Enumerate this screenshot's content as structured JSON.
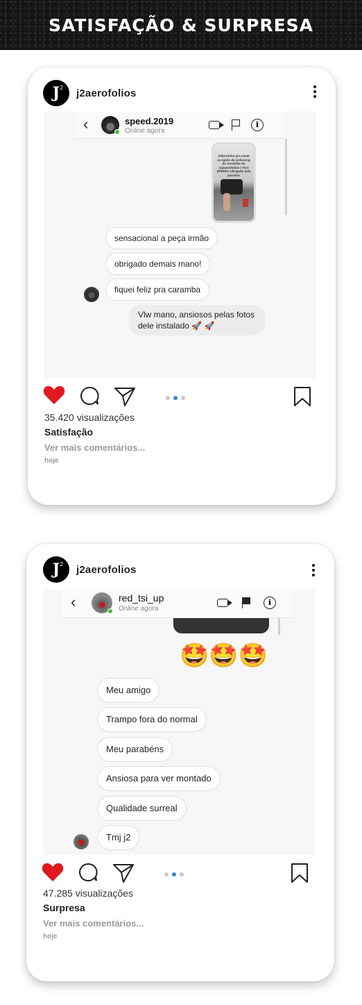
{
  "banner": {
    "title": "SATISFAÇÃO & SURPRESA"
  },
  "posts": [
    {
      "account": {
        "username": "j2aerofolios",
        "logo_letter": "J",
        "logo_sup": "2"
      },
      "chat": {
        "contact": "speed.2019",
        "status": "Online agora",
        "story_text": "Videozinho pra canal no Ignite do Unboxing do Aerofólio do @j2aerofolios | TSI | SPEED!! obrigado pela parceria",
        "incoming": [
          "sensacional a peça irmão",
          "obrigado demais mano!",
          "fiquei feliz pra caramba"
        ],
        "outgoing": [
          "Vlw mano, ansiosos pelas fotos dele instalado 🚀 🚀"
        ]
      },
      "views": "35.420 visualizações",
      "caption": "Satisfação",
      "more_comments": "Ver mais comentários...",
      "date": "hoje"
    },
    {
      "account": {
        "username": "j2aerofolios",
        "logo_letter": "J",
        "logo_sup": "2"
      },
      "chat": {
        "contact": "red_tsi_up",
        "status": "Online agora",
        "emojis": "🤩🤩🤩",
        "incoming": [
          "Meu amigo",
          "Trampo fora do normal",
          "Meu parabéns",
          "Ansiosa para ver montado",
          "Qualidade surreal",
          "Tmj j2"
        ]
      },
      "views": "47.285 visualizações",
      "caption": "Surpresa",
      "more_comments": "Ver mais comentários...",
      "date": "hoje"
    }
  ],
  "icons": [
    "heart-icon",
    "comment-icon",
    "share-icon",
    "bookmark-icon",
    "back-icon",
    "video-call-icon",
    "flag-icon",
    "info-icon",
    "more-options-icon"
  ],
  "colors": {
    "heart": "#e0191e",
    "dot_active": "#3b82d6",
    "online": "#43c243",
    "banner_bg": "#151515"
  }
}
